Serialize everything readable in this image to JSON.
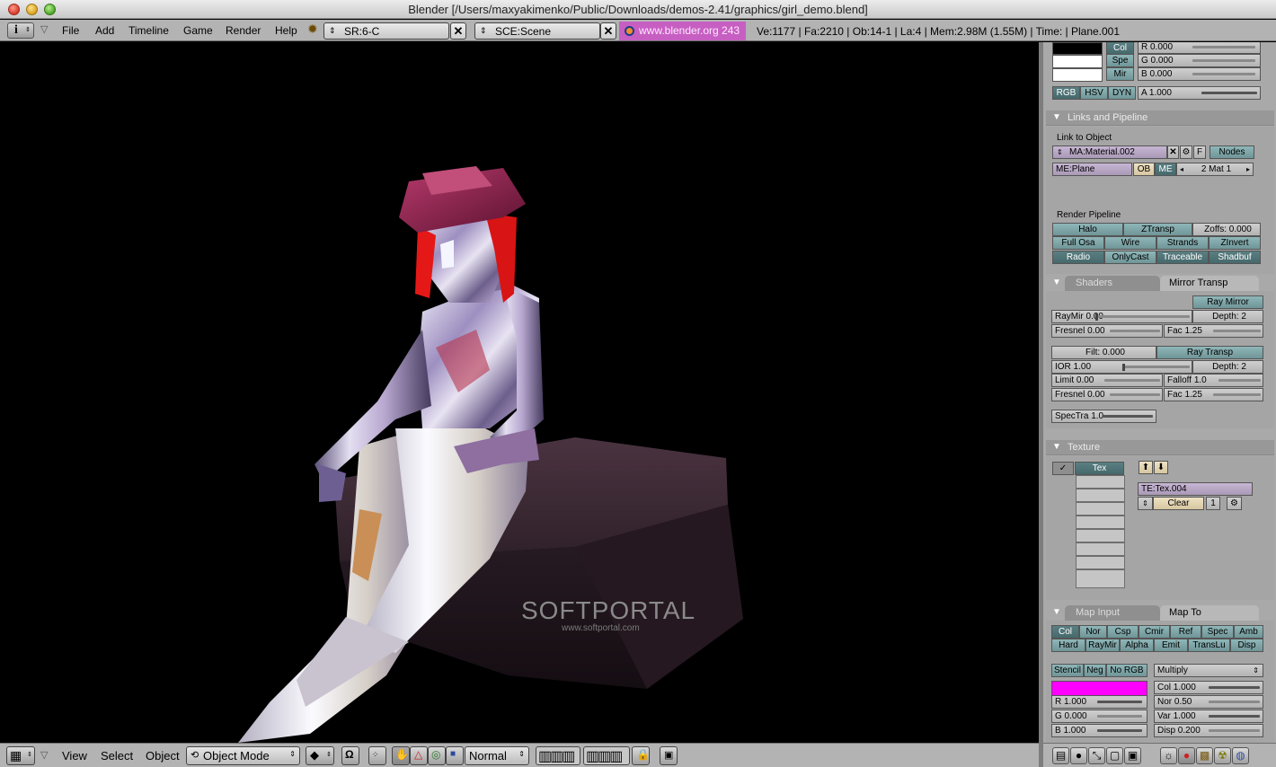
{
  "window": {
    "title": "Blender [/Users/maxyakimenko/Public/Downloads/demos-2.41/graphics/girl_demo.blend]"
  },
  "header": {
    "menus": [
      "File",
      "Add",
      "Timeline",
      "Game",
      "Render",
      "Help"
    ],
    "screen_field": "SR:6-C",
    "scene_field": "SCE:Scene",
    "url": "www.blender.org 243",
    "stats": "Ve:1177 | Fa:2210 | Ob:14-1 | La:4  | Mem:2.98M (1.55M)  | Time: | Plane.001"
  },
  "viewport": {
    "watermark": "SOFTPORTAL",
    "watermark_url": "www.softportal.com"
  },
  "view3d_header": {
    "menus": [
      "View",
      "Select",
      "Object"
    ],
    "mode": "Object Mode",
    "pivot": "Normal"
  },
  "material": {
    "color_tabs": [
      "Col",
      "Spe",
      "Mir"
    ],
    "rgb_values": [
      "R 0.000",
      "G 0.000",
      "B 0.000"
    ],
    "model_buttons": [
      "RGB",
      "HSV",
      "DYN"
    ],
    "alpha": "A 1.000"
  },
  "links": {
    "title": "Links and Pipeline",
    "link_label": "Link to Object",
    "material_name": "MA:Material.002",
    "f_button": "F",
    "nodes_button": "Nodes",
    "mesh_name": "ME:Plane",
    "ob_button": "OB",
    "me_button": "ME",
    "mat_count": "2 Mat 1",
    "pipeline_label": "Render Pipeline",
    "row1": [
      "Halo",
      "ZTransp"
    ],
    "zoffs": "Zoffs: 0.000",
    "row2": [
      "Full Osa",
      "Wire",
      "Strands",
      "ZInvert"
    ],
    "row3": [
      "Radio",
      "OnlyCast",
      "Traceable",
      "Shadbuf"
    ]
  },
  "mirror": {
    "tab_shaders": "Shaders",
    "tab_mirror": "Mirror Transp",
    "ray_mirror": "Ray Mirror",
    "raymir": "RayMir 0.00",
    "depth1": "Depth: 2",
    "fresnel1": "Fresnel 0.00",
    "fac1": "Fac 1.25",
    "filt": "Filt: 0.000",
    "ray_transp": "Ray Transp",
    "ior": "IOR 1.00",
    "depth2": "Depth: 2",
    "limit": "Limit 0.00",
    "falloff": "Falloff 1.0",
    "fresnel2": "Fresnel 0.00",
    "fac2": "Fac 1.25",
    "spectra": "SpecTra 1.0"
  },
  "texture": {
    "title": "Texture",
    "tex_slot": "Tex",
    "te_name": "TE:Tex.004",
    "clear": "Clear",
    "users": "1"
  },
  "mapping": {
    "tab_input": "Map Input",
    "tab_to": "Map To",
    "row1": [
      "Col",
      "Nor",
      "Csp",
      "Cmir",
      "Ref",
      "Spec",
      "Amb"
    ],
    "row2": [
      "Hard",
      "RayMir",
      "Alpha",
      "Emit",
      "TransLu",
      "Disp"
    ],
    "row3": [
      "Stencil",
      "Neg",
      "No RGB"
    ],
    "blend": "Multiply",
    "tex_color": "#ff00ff",
    "r": "R 1.000",
    "g": "G 0.000",
    "b": "B 1.000",
    "col": "Col 1.000",
    "nor": "Nor 0.50",
    "var": "Var 1.000",
    "disp": "Disp 0.200"
  }
}
